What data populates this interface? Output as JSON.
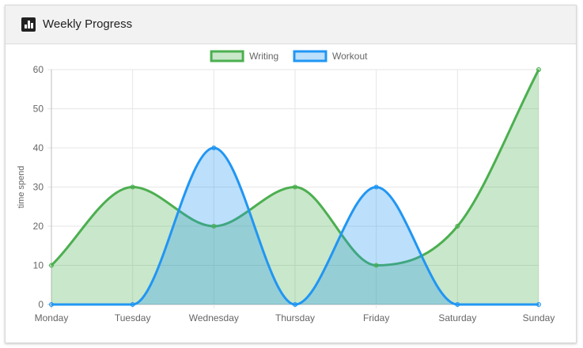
{
  "header": {
    "title": "Weekly Progress",
    "icon": "bar-chart-icon"
  },
  "chart_data": {
    "type": "line",
    "x": [
      "Monday",
      "Tuesday",
      "Wednesday",
      "Thursday",
      "Friday",
      "Saturday",
      "Sunday"
    ],
    "series": [
      {
        "name": "Writing",
        "values": [
          10,
          30,
          20,
          30,
          10,
          20,
          60
        ],
        "color": "#4caf50",
        "fill": "rgba(76,175,80,0.30)"
      },
      {
        "name": "Workout",
        "values": [
          0,
          0,
          40,
          0,
          30,
          0,
          0
        ],
        "color": "#2196f3",
        "fill": "rgba(33,150,243,0.30)"
      }
    ],
    "ylabel": "time spend",
    "xlabel": "",
    "ylim": [
      0,
      60
    ],
    "yticks": [
      0,
      10,
      20,
      30,
      40,
      50,
      60
    ],
    "grid": true,
    "legend": "top-center",
    "curve": "smooth",
    "filled": true
  }
}
